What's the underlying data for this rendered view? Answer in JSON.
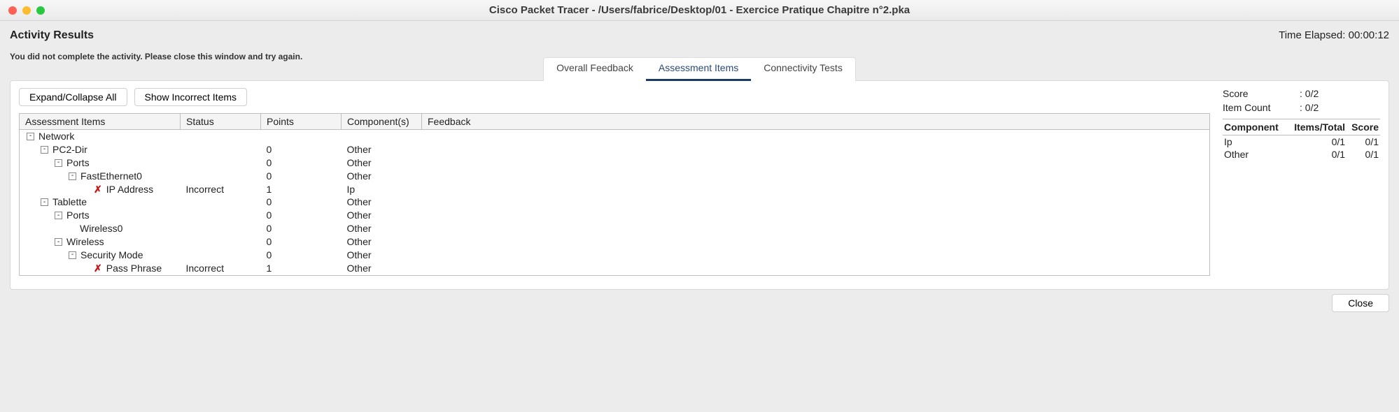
{
  "window": {
    "title": "Cisco Packet Tracer - /Users/fabrice/Desktop/01 - Exercice Pratique Chapitre n°2.pka"
  },
  "header": {
    "activity_heading": "Activity Results",
    "time_elapsed_label": "Time Elapsed: ",
    "time_elapsed_value": "00:00:12",
    "warning": "You did not complete the activity. Please close this window and try again."
  },
  "tabs": {
    "overall": "Overall Feedback",
    "assessment": "Assessment Items",
    "connectivity": "Connectivity Tests"
  },
  "buttons": {
    "expand_collapse": "Expand/Collapse All",
    "show_incorrect": "Show Incorrect Items",
    "close": "Close"
  },
  "tree_headers": {
    "items": "Assessment Items",
    "status": "Status",
    "points": "Points",
    "components": "Component(s)",
    "feedback": "Feedback"
  },
  "tree": [
    {
      "indent": 0,
      "twisty": "-",
      "name": "Network",
      "status": "",
      "points": "",
      "components": ""
    },
    {
      "indent": 1,
      "twisty": "-",
      "name": "PC2-Dir",
      "status": "",
      "points": "0",
      "components": "Other"
    },
    {
      "indent": 2,
      "twisty": "-",
      "name": "Ports",
      "status": "",
      "points": "0",
      "components": "Other"
    },
    {
      "indent": 3,
      "twisty": "-",
      "name": "FastEthernet0",
      "status": "",
      "points": "0",
      "components": "Other"
    },
    {
      "indent": 4,
      "twisty": "",
      "mark": "x",
      "name": "IP Address",
      "status": "Incorrect",
      "points": "1",
      "components": "Ip"
    },
    {
      "indent": 1,
      "twisty": "-",
      "name": "Tablette",
      "status": "",
      "points": "0",
      "components": "Other"
    },
    {
      "indent": 2,
      "twisty": "-",
      "name": "Ports",
      "status": "",
      "points": "0",
      "components": "Other"
    },
    {
      "indent": 3,
      "twisty": "",
      "name": "Wireless0",
      "status": "",
      "points": "0",
      "components": "Other"
    },
    {
      "indent": 2,
      "twisty": "-",
      "name": "Wireless",
      "status": "",
      "points": "0",
      "components": "Other"
    },
    {
      "indent": 3,
      "twisty": "-",
      "name": "Security Mode",
      "status": "",
      "points": "0",
      "components": "Other"
    },
    {
      "indent": 4,
      "twisty": "",
      "mark": "x",
      "name": "Pass Phrase",
      "status": "Incorrect",
      "points": "1",
      "components": "Other"
    }
  ],
  "score_summary": {
    "score_label": "Score",
    "score_value": ": 0/2",
    "count_label": "Item Count",
    "count_value": ": 0/2"
  },
  "comp_table": {
    "h_component": "Component",
    "h_items": "Items/Total",
    "h_score": "Score",
    "rows": [
      {
        "name": "Ip",
        "items": "0/1",
        "score": "0/1"
      },
      {
        "name": "Other",
        "items": "0/1",
        "score": "0/1"
      }
    ]
  }
}
